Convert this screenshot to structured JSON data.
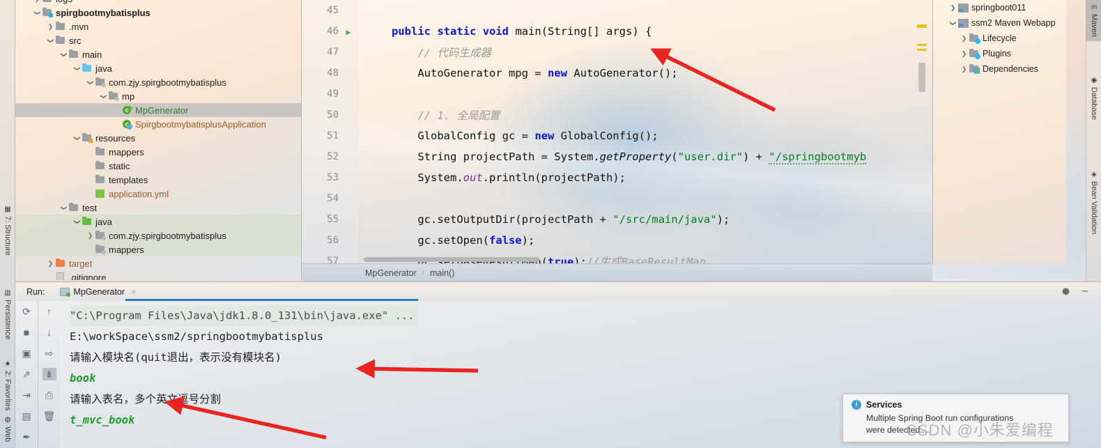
{
  "left_tool_tabs": [
    {
      "label": "7: Structure",
      "icon": "structure-icon"
    },
    {
      "label": "Persistence",
      "icon": "persistence-icon"
    },
    {
      "label": "2: Favorites",
      "icon": "star-icon"
    },
    {
      "label": "Web",
      "icon": "globe-icon"
    }
  ],
  "right_tool_tabs": [
    {
      "label": "Maven",
      "icon": "maven-icon"
    },
    {
      "label": "Database",
      "icon": "database-icon"
    },
    {
      "label": "Bean Validation",
      "icon": "bean-validation-icon"
    }
  ],
  "project_tree": [
    {
      "label": "logs",
      "indent": 1,
      "arrow": "collapsed",
      "icon": "folder",
      "style": "",
      "partial": true
    },
    {
      "label": "spirgbootmybatisplus",
      "indent": 1,
      "arrow": "expanded",
      "icon": "folder-module",
      "style": "bold"
    },
    {
      "label": ".mvn",
      "indent": 2,
      "arrow": "collapsed",
      "icon": "folder",
      "style": ""
    },
    {
      "label": "src",
      "indent": 2,
      "arrow": "expanded",
      "icon": "folder",
      "style": ""
    },
    {
      "label": "main",
      "indent": 3,
      "arrow": "expanded",
      "icon": "folder",
      "style": ""
    },
    {
      "label": "java",
      "indent": 4,
      "arrow": "expanded",
      "icon": "folder-source",
      "style": ""
    },
    {
      "label": "com.zjy.spirgbootmybatisplus",
      "indent": 5,
      "arrow": "expanded",
      "icon": "package",
      "style": ""
    },
    {
      "label": "mp",
      "indent": 6,
      "arrow": "expanded",
      "icon": "package",
      "style": ""
    },
    {
      "label": "MpGenerator",
      "indent": 7,
      "arrow": "none",
      "icon": "class-runnable",
      "style": "green",
      "selected": true
    },
    {
      "label": "SpirgbootmybatisplusApplication",
      "indent": 7,
      "arrow": "none",
      "icon": "class-spring",
      "style": "brown"
    },
    {
      "label": "resources",
      "indent": 4,
      "arrow": "expanded",
      "icon": "folder-resources",
      "style": ""
    },
    {
      "label": "mappers",
      "indent": 5,
      "arrow": "none",
      "icon": "folder",
      "style": ""
    },
    {
      "label": "static",
      "indent": 5,
      "arrow": "none",
      "icon": "folder",
      "style": ""
    },
    {
      "label": "templates",
      "indent": 5,
      "arrow": "none",
      "icon": "folder",
      "style": ""
    },
    {
      "label": "application.yml",
      "indent": 5,
      "arrow": "none",
      "icon": "yml-file",
      "style": "brown"
    },
    {
      "label": "test",
      "indent": 3,
      "arrow": "expanded",
      "icon": "folder",
      "style": ""
    },
    {
      "label": "java",
      "indent": 4,
      "arrow": "expanded",
      "icon": "folder-test-source",
      "style": ""
    },
    {
      "label": "com.zjy.spirgbootmybatisplus",
      "indent": 5,
      "arrow": "collapsed",
      "icon": "package",
      "style": ""
    },
    {
      "label": "mappers",
      "indent": 5,
      "arrow": "none",
      "icon": "package",
      "style": ""
    },
    {
      "label": "target",
      "indent": 2,
      "arrow": "collapsed",
      "icon": "folder-excluded",
      "style": "brown"
    },
    {
      "label": ".gitignore",
      "indent": 2,
      "arrow": "none",
      "icon": "git-file",
      "style": ""
    }
  ],
  "editor": {
    "lines": [
      {
        "num": "45",
        "runnable": false,
        "fold": false
      },
      {
        "num": "46",
        "runnable": true,
        "fold": true
      },
      {
        "num": "47",
        "runnable": false,
        "fold": false
      },
      {
        "num": "48",
        "runnable": false,
        "fold": false
      },
      {
        "num": "49",
        "runnable": false,
        "fold": false
      },
      {
        "num": "50",
        "runnable": false,
        "fold": false
      },
      {
        "num": "51",
        "runnable": false,
        "fold": false
      },
      {
        "num": "52",
        "runnable": false,
        "fold": false
      },
      {
        "num": "53",
        "runnable": false,
        "fold": false
      },
      {
        "num": "54",
        "runnable": false,
        "fold": false
      },
      {
        "num": "55",
        "runnable": false,
        "fold": false
      },
      {
        "num": "56",
        "runnable": false,
        "fold": false
      },
      {
        "num": "57",
        "runnable": false,
        "fold": false
      }
    ],
    "code": {
      "l45": "",
      "l46_kw1": "public",
      "l46_kw2": "static",
      "l46_kw3": "void",
      "l46_rest": " main(String[] args) {",
      "l47": "// 代码生成器",
      "l48_a": "AutoGenerator mpg = ",
      "l48_kw": "new",
      "l48_b": " AutoGenerator();",
      "l50": "// 1. 全局配置",
      "l51_a": "GlobalConfig gc = ",
      "l51_kw": "new",
      "l51_b": " GlobalConfig();",
      "l52_a": "String projectPath = System.",
      "l52_m": "getProperty",
      "l52_b": "(",
      "l52_s1": "\"user.dir\"",
      "l52_c": ") + ",
      "l52_s2": "\"/springbootmyb",
      "l53_a": "System.",
      "l53_f": "out",
      "l53_b": ".println(projectPath);",
      "l55_a": "gc.setOutputDir(projectPath + ",
      "l55_s": "\"/src/main/java\"",
      "l55_b": ");",
      "l56_a": "gc.setOpen(",
      "l56_kw": "false",
      "l56_b": ");",
      "l57_a": "gc.setBaseResultMap(",
      "l57_kw": "true",
      "l57_b": ");",
      "l57_c": "//生成BaseResultMap"
    }
  },
  "breadcrumb": {
    "class": "MpGenerator",
    "separator": "›",
    "method": "main()"
  },
  "maven_tree": [
    {
      "label": "springboot011",
      "indent": 1,
      "arrow": "collapsed",
      "icon": "maven-project"
    },
    {
      "label": "ssm2 Maven Webapp",
      "indent": 1,
      "arrow": "expanded",
      "icon": "maven-project"
    },
    {
      "label": "Lifecycle",
      "indent": 2,
      "arrow": "collapsed",
      "icon": "lifecycle-folder"
    },
    {
      "label": "Plugins",
      "indent": 2,
      "arrow": "collapsed",
      "icon": "plugins-folder"
    },
    {
      "label": "Dependencies",
      "indent": 2,
      "arrow": "collapsed",
      "icon": "dependencies-folder"
    }
  ],
  "run_window": {
    "title": "Run:",
    "tab_label": "MpGenerator",
    "close_label": "×",
    "settings_icon": "gear-icon",
    "minimize_icon": "minimize-icon",
    "toolbar_left": [
      {
        "name": "rerun-icon",
        "glyph": "⟳"
      },
      {
        "name": "stop-icon",
        "glyph": "■"
      },
      {
        "name": "camera-icon",
        "glyph": "▣"
      },
      {
        "name": "thread-dump-icon",
        "glyph": "⇗"
      },
      {
        "name": "export-icon",
        "glyph": "⇥"
      },
      {
        "name": "layout-icon",
        "glyph": "▤"
      },
      {
        "name": "pin-icon",
        "glyph": "✒"
      }
    ],
    "toolbar_right": [
      {
        "name": "up-arrow-icon",
        "glyph": "↑"
      },
      {
        "name": "down-arrow-icon",
        "glyph": "↓"
      },
      {
        "name": "soft-wrap-icon",
        "glyph": "⇨"
      },
      {
        "name": "scroll-to-end-icon",
        "glyph": "⇟"
      },
      {
        "name": "print-icon",
        "glyph": "⎙"
      },
      {
        "name": "trash-icon",
        "glyph": "🗑"
      }
    ],
    "console_lines": [
      {
        "text": "\"C:\\Program Files\\Java\\jdk1.8.0_131\\bin\\java.exe\" ...",
        "kind": "command"
      },
      {
        "text": "E:\\workSpace\\ssm2/springbootmybatisplus",
        "kind": "output"
      },
      {
        "text": "请输入模块名(quit退出，表示没有模块名)",
        "kind": "output"
      },
      {
        "text": "book",
        "kind": "input"
      },
      {
        "text": "请输入表名，多个英文逗号分割",
        "kind": "output"
      },
      {
        "text": "t_mvc_book",
        "kind": "input"
      }
    ]
  },
  "notification": {
    "icon": "info-icon",
    "title": "Services",
    "body_line1": "Multiple Spring Boot run configurations",
    "body_line2": "were detected...."
  },
  "watermark": "CSDN @小朱爱编程",
  "colors": {
    "accent_blue": "#3b73b9",
    "keyword": "#0b16d8",
    "string": "#067d17",
    "comment": "#9b9b9b",
    "input_green": "#1e9e2e",
    "arrow_red": "#e8251f",
    "selection_gray": "#c9c5c0"
  }
}
